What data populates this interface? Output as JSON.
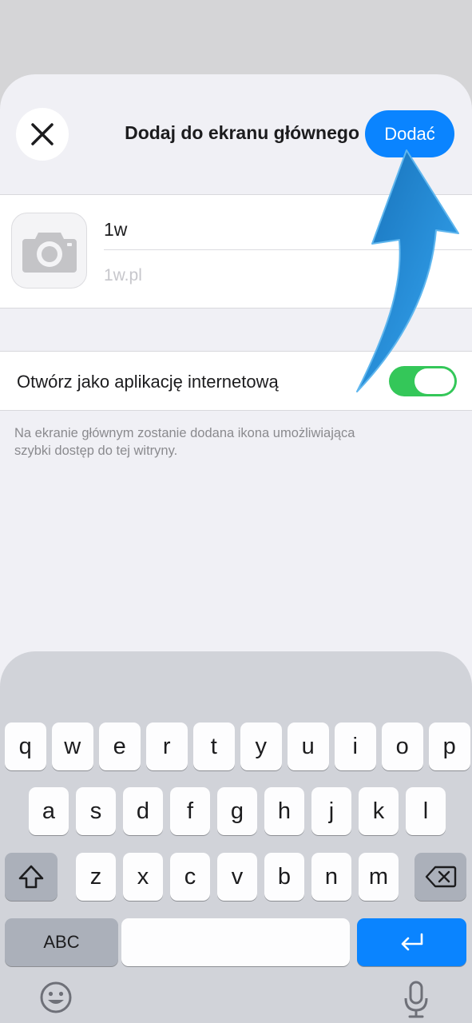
{
  "sheet": {
    "title": "Dodaj do ekranu głównego",
    "add_label": "Dodać",
    "name_value": "1w",
    "url_placeholder": "1w.pl",
    "toggle_label": "Otwórz jako aplikację internetową",
    "toggle_on": true,
    "footnote": "Na ekranie głównym zostanie dodana ikona umożliwiająca szybki dostęp do tej witryny."
  },
  "keyboard": {
    "row1": [
      "q",
      "w",
      "e",
      "r",
      "t",
      "y",
      "u",
      "i",
      "o",
      "p"
    ],
    "row2": [
      "a",
      "s",
      "d",
      "f",
      "g",
      "h",
      "j",
      "k",
      "l"
    ],
    "row3": [
      "z",
      "x",
      "c",
      "v",
      "b",
      "n",
      "m"
    ],
    "abc_label": "ABC"
  },
  "colors": {
    "accent": "#0a84ff",
    "toggle": "#34c759",
    "arrow": "#1f86d0"
  },
  "icons": [
    "close-icon",
    "camera-icon",
    "shift-icon",
    "backspace-icon",
    "return-icon",
    "emoji-icon",
    "microphone-icon",
    "arrow-pointer"
  ]
}
